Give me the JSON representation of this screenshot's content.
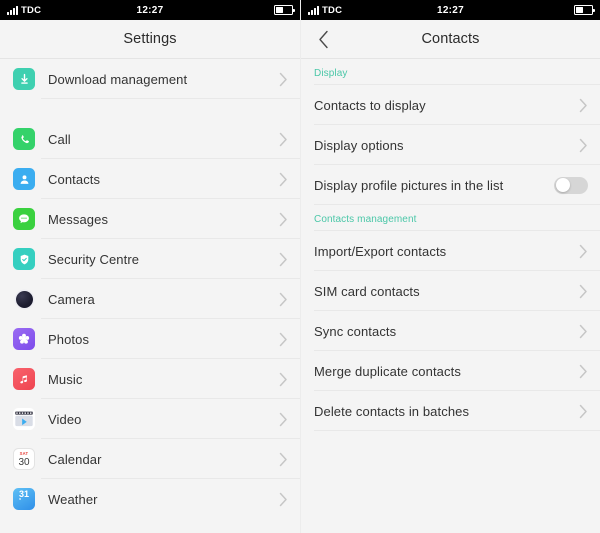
{
  "status_bar": {
    "carrier": "TDC",
    "time": "12:27",
    "signal_icon": "signal-bars-icon",
    "battery_icon": "battery-icon"
  },
  "left_screen": {
    "title": "Settings",
    "groups": [
      {
        "items": [
          {
            "label": "Download management",
            "icon": "download-icon",
            "chevron": "chevron-right-icon"
          }
        ]
      },
      {
        "items": [
          {
            "label": "Call",
            "icon": "phone-icon",
            "chevron": "chevron-right-icon"
          },
          {
            "label": "Contacts",
            "icon": "person-icon",
            "chevron": "chevron-right-icon"
          },
          {
            "label": "Messages",
            "icon": "message-bubble-icon",
            "chevron": "chevron-right-icon"
          },
          {
            "label": "Security Centre",
            "icon": "shield-check-icon",
            "chevron": "chevron-right-icon"
          },
          {
            "label": "Camera",
            "icon": "camera-lens-icon",
            "chevron": "chevron-right-icon"
          },
          {
            "label": "Photos",
            "icon": "flower-photos-icon",
            "chevron": "chevron-right-icon"
          },
          {
            "label": "Music",
            "icon": "music-note-icon",
            "chevron": "chevron-right-icon"
          },
          {
            "label": "Video",
            "icon": "video-play-icon",
            "chevron": "chevron-right-icon"
          },
          {
            "label": "Calendar",
            "icon": "calendar-icon",
            "chevron": "chevron-right-icon"
          },
          {
            "label": "Weather",
            "icon": "weather-icon",
            "chevron": "chevron-right-icon"
          }
        ]
      }
    ],
    "calendar_icon": {
      "weekday": "SAT",
      "day": "30"
    },
    "weather_icon": {
      "temperature": "31",
      "degree": "°"
    }
  },
  "right_screen": {
    "title": "Contacts",
    "back_icon": "chevron-left-icon",
    "sections": [
      {
        "header": "Display",
        "items": [
          {
            "label": "Contacts to display",
            "control": "chevron",
            "chevron": "chevron-right-icon"
          },
          {
            "label": "Display options",
            "control": "chevron",
            "chevron": "chevron-right-icon"
          },
          {
            "label": "Display profile pictures in the list",
            "control": "toggle",
            "toggle_on": false
          }
        ]
      },
      {
        "header": "Contacts management",
        "items": [
          {
            "label": "Import/Export contacts",
            "control": "chevron",
            "chevron": "chevron-right-icon"
          },
          {
            "label": "SIM card contacts",
            "control": "chevron",
            "chevron": "chevron-right-icon"
          },
          {
            "label": "Sync contacts",
            "control": "chevron",
            "chevron": "chevron-right-icon"
          },
          {
            "label": "Merge duplicate contacts",
            "control": "chevron",
            "chevron": "chevron-right-icon"
          },
          {
            "label": "Delete contacts in batches",
            "control": "chevron",
            "chevron": "chevron-right-icon"
          }
        ]
      }
    ]
  },
  "colors": {
    "section_header": "#4bc7a8",
    "background": "#f4f4f4",
    "separator": "#e8e8e8",
    "text": "#333333",
    "toggle_off": "#d6d6d6"
  }
}
